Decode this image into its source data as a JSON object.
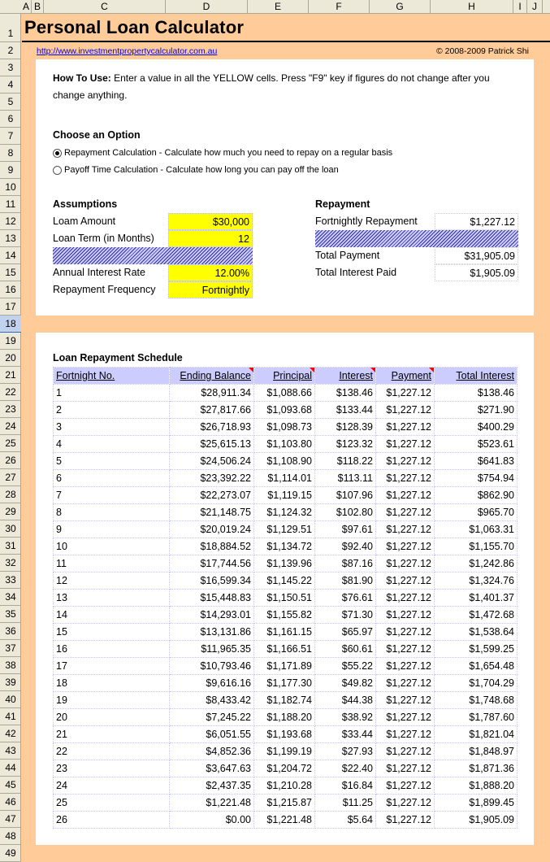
{
  "spreadsheet": {
    "column_headers": [
      "A",
      "B",
      "C",
      "D",
      "E",
      "F",
      "G",
      "H",
      "I",
      "J"
    ],
    "row_numbers": [
      "1",
      "2",
      "3",
      "4",
      "5",
      "6",
      "7",
      "8",
      "9",
      "10",
      "11",
      "12",
      "13",
      "14",
      "15",
      "16",
      "17",
      "18",
      "19",
      "20",
      "21",
      "22",
      "23",
      "24",
      "25",
      "26",
      "27",
      "28",
      "29",
      "30",
      "31",
      "32",
      "33",
      "34",
      "35",
      "36",
      "37",
      "38",
      "39",
      "40",
      "41",
      "42",
      "43",
      "44",
      "45",
      "46",
      "47",
      "48",
      "49"
    ],
    "selected_row": "18"
  },
  "header": {
    "title": "Personal Loan Calculator",
    "url": "http://www.investmentpropertycalculator.com.au",
    "copyright": "© 2008-2009 Patrick Shi"
  },
  "instructions": {
    "label": "How To Use:",
    "text": " Enter a value in all the YELLOW cells. Press \"F9\" key if figures do not change after you change anything."
  },
  "options": {
    "title": "Choose an Option",
    "items": [
      {
        "label": "Repayment Calculation - Calculate how much you need to repay on a regular basis",
        "selected": true
      },
      {
        "label": "Payoff Time Calculation - Calculate how long you can pay off the loan",
        "selected": false
      }
    ]
  },
  "assumptions": {
    "title": "Assumptions",
    "loan_amount_label": "Loam Amount",
    "loan_amount": "$30,000",
    "loan_term_label": "Loan Term (in Months)",
    "loan_term": "12",
    "interest_rate_label": "Annual Interest Rate",
    "interest_rate": "12.00%",
    "frequency_label": "Repayment Frequency",
    "frequency": "Fortnightly"
  },
  "repayment": {
    "title": "Repayment",
    "fortnightly_label": "Fortnightly Repayment",
    "fortnightly_value": "$1,227.12",
    "total_payment_label": "Total Payment",
    "total_payment_value": "$31,905.09",
    "total_interest_label": "Total Interest Paid",
    "total_interest_value": "$1,905.09"
  },
  "schedule": {
    "title": "Loan Repayment Schedule",
    "columns": [
      "Fortnight No.",
      "Ending Balance",
      "Principal",
      "Interest",
      "Payment",
      "Total Interest"
    ],
    "rows": [
      [
        "1",
        "$28,911.34",
        "$1,088.66",
        "$138.46",
        "$1,227.12",
        "$138.46"
      ],
      [
        "2",
        "$27,817.66",
        "$1,093.68",
        "$133.44",
        "$1,227.12",
        "$271.90"
      ],
      [
        "3",
        "$26,718.93",
        "$1,098.73",
        "$128.39",
        "$1,227.12",
        "$400.29"
      ],
      [
        "4",
        "$25,615.13",
        "$1,103.80",
        "$123.32",
        "$1,227.12",
        "$523.61"
      ],
      [
        "5",
        "$24,506.24",
        "$1,108.90",
        "$118.22",
        "$1,227.12",
        "$641.83"
      ],
      [
        "6",
        "$23,392.22",
        "$1,114.01",
        "$113.11",
        "$1,227.12",
        "$754.94"
      ],
      [
        "7",
        "$22,273.07",
        "$1,119.15",
        "$107.96",
        "$1,227.12",
        "$862.90"
      ],
      [
        "8",
        "$21,148.75",
        "$1,124.32",
        "$102.80",
        "$1,227.12",
        "$965.70"
      ],
      [
        "9",
        "$20,019.24",
        "$1,129.51",
        "$97.61",
        "$1,227.12",
        "$1,063.31"
      ],
      [
        "10",
        "$18,884.52",
        "$1,134.72",
        "$92.40",
        "$1,227.12",
        "$1,155.70"
      ],
      [
        "11",
        "$17,744.56",
        "$1,139.96",
        "$87.16",
        "$1,227.12",
        "$1,242.86"
      ],
      [
        "12",
        "$16,599.34",
        "$1,145.22",
        "$81.90",
        "$1,227.12",
        "$1,324.76"
      ],
      [
        "13",
        "$15,448.83",
        "$1,150.51",
        "$76.61",
        "$1,227.12",
        "$1,401.37"
      ],
      [
        "14",
        "$14,293.01",
        "$1,155.82",
        "$71.30",
        "$1,227.12",
        "$1,472.68"
      ],
      [
        "15",
        "$13,131.86",
        "$1,161.15",
        "$65.97",
        "$1,227.12",
        "$1,538.64"
      ],
      [
        "16",
        "$11,965.35",
        "$1,166.51",
        "$60.61",
        "$1,227.12",
        "$1,599.25"
      ],
      [
        "17",
        "$10,793.46",
        "$1,171.89",
        "$55.22",
        "$1,227.12",
        "$1,654.48"
      ],
      [
        "18",
        "$9,616.16",
        "$1,177.30",
        "$49.82",
        "$1,227.12",
        "$1,704.29"
      ],
      [
        "19",
        "$8,433.42",
        "$1,182.74",
        "$44.38",
        "$1,227.12",
        "$1,748.68"
      ],
      [
        "20",
        "$7,245.22",
        "$1,188.20",
        "$38.92",
        "$1,227.12",
        "$1,787.60"
      ],
      [
        "21",
        "$6,051.55",
        "$1,193.68",
        "$33.44",
        "$1,227.12",
        "$1,821.04"
      ],
      [
        "22",
        "$4,852.36",
        "$1,199.19",
        "$27.93",
        "$1,227.12",
        "$1,848.97"
      ],
      [
        "23",
        "$3,647.63",
        "$1,204.72",
        "$22.40",
        "$1,227.12",
        "$1,871.36"
      ],
      [
        "24",
        "$2,437.35",
        "$1,210.28",
        "$16.84",
        "$1,227.12",
        "$1,888.20"
      ],
      [
        "25",
        "$1,221.48",
        "$1,215.87",
        "$11.25",
        "$1,227.12",
        "$1,899.45"
      ],
      [
        "26",
        "$0.00",
        "$1,221.48",
        "$5.64",
        "$1,227.12",
        "$1,905.09"
      ]
    ]
  }
}
